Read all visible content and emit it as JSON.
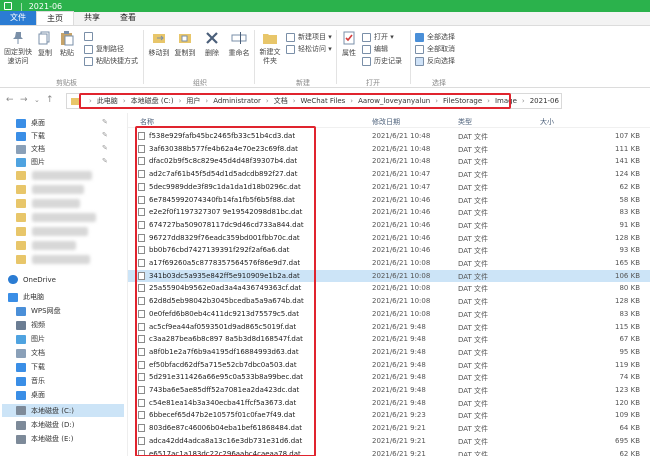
{
  "window": {
    "title": "2021-06"
  },
  "ribbon_tabs": [
    "文件",
    "主页",
    "共享",
    "查看"
  ],
  "ribbon": {
    "clipboard": {
      "pin_label": "固定到快速访问",
      "copy": "复制",
      "paste": "粘贴",
      "copy_path": "复制路径",
      "paste_shortcut": "粘贴快捷方式",
      "group": "剪贴板"
    },
    "organize": {
      "move_to": "移动到",
      "copy_to": "复制到",
      "delete": "删除",
      "rename": "重命名",
      "group": "组织"
    },
    "new": {
      "new_folder": "新建文件夹",
      "new_item": "新建项目 ▾",
      "easy_access": "轻松访问 ▾",
      "group": "新建"
    },
    "open": {
      "properties": "属性",
      "open": "打开 ▾",
      "edit": "编辑",
      "history": "历史记录",
      "group": "打开"
    },
    "select": {
      "select_all": "全部选择",
      "select_none": "全部取消",
      "invert": "反向选择",
      "group": "选择"
    }
  },
  "breadcrumb": [
    "此电脑",
    "本地磁盘 (C:)",
    "用户",
    "Administrator",
    "文档",
    "WeChat Files",
    "Aarow_loveyanyalun",
    "FileStorage",
    "Image",
    "2021-06"
  ],
  "sidebar": {
    "quick": [
      {
        "label": "桌面",
        "icon": "desktop-icon"
      },
      {
        "label": "下载",
        "icon": "download-icon"
      },
      {
        "label": "文档",
        "icon": "document-icon"
      },
      {
        "label": "图片",
        "icon": "picture-icon"
      }
    ],
    "desktop2": "桌面",
    "onedrive": "OneDrive",
    "pc": "此电脑",
    "pc_items": [
      {
        "label": "WPS网盘",
        "icon": "cloud-icon"
      },
      {
        "label": "视频",
        "icon": "video-icon"
      },
      {
        "label": "图片",
        "icon": "picture-icon"
      },
      {
        "label": "文档",
        "icon": "document-icon"
      },
      {
        "label": "下载",
        "icon": "download-icon"
      },
      {
        "label": "音乐",
        "icon": "music-icon"
      },
      {
        "label": "桌面",
        "icon": "desktop-icon"
      },
      {
        "label": "本地磁盘 (C:)",
        "icon": "drive-icon"
      },
      {
        "label": "本地磁盘 (D:)",
        "icon": "drive-icon"
      },
      {
        "label": "本地磁盘 (E:)",
        "icon": "drive-icon"
      }
    ]
  },
  "columns": {
    "name": "名称",
    "date": "修改日期",
    "type": "类型",
    "size": "大小"
  },
  "files": [
    {
      "name": "f538e929fafb45bc2465fb33c51b4cd3.dat",
      "date": "2021/6/21 10:48",
      "type": "DAT 文件",
      "size": "107 KB"
    },
    {
      "name": "3af630388b577fe4b62a4e70e23c69f8.dat",
      "date": "2021/6/21 10:48",
      "type": "DAT 文件",
      "size": "111 KB"
    },
    {
      "name": "dfac02b9f5c8c829e45d4d48f39307b4.dat",
      "date": "2021/6/21 10:48",
      "type": "DAT 文件",
      "size": "141 KB"
    },
    {
      "name": "ad2c7af61b45f5d54d1d5adcdb892f27.dat",
      "date": "2021/6/21 10:47",
      "type": "DAT 文件",
      "size": "124 KB"
    },
    {
      "name": "5dec9989dde3f89c1da1da1d18b0296c.dat",
      "date": "2021/6/21 10:47",
      "type": "DAT 文件",
      "size": "62 KB"
    },
    {
      "name": "6e7845992074340fb14fa1fb5f6b5f88.dat",
      "date": "2021/6/21 10:46",
      "type": "DAT 文件",
      "size": "58 KB"
    },
    {
      "name": "e2e2f0f1197327307 9e19542098d81bc.dat",
      "date": "2021/6/21 10:46",
      "type": "DAT 文件",
      "size": "83 KB"
    },
    {
      "name": "674727ba509078117dc9d46cd733a844.dat",
      "date": "2021/6/21 10:46",
      "type": "DAT 文件",
      "size": "91 KB"
    },
    {
      "name": "96727dd8329f76eadc359bd001fbb70c.dat",
      "date": "2021/6/21 10:46",
      "type": "DAT 文件",
      "size": "128 KB"
    },
    {
      "name": "bb0b76cbd7427139391f292f2af6a6.dat",
      "date": "2021/6/21 10:46",
      "type": "DAT 文件",
      "size": "93 KB"
    },
    {
      "name": "a17f69260a5c8778357564576f86e9d7.dat",
      "date": "2021/6/21 10:08",
      "type": "DAT 文件",
      "size": "165 KB"
    },
    {
      "name": "341b03dc5a935e842ff5e910909e1b2a.dat",
      "date": "2021/6/21 10:08",
      "type": "DAT 文件",
      "size": "106 KB",
      "selected": true
    },
    {
      "name": "25a55904b9562e0ad3a4a436749363cf.dat",
      "date": "2021/6/21 10:08",
      "type": "DAT 文件",
      "size": "80 KB"
    },
    {
      "name": "62d8d5eb98042b3045bcedba5a9a674b.dat",
      "date": "2021/6/21 10:08",
      "type": "DAT 文件",
      "size": "128 KB"
    },
    {
      "name": "0e0fefd6b80eb4c411dc9213d75579c5.dat",
      "date": "2021/6/21 10:08",
      "type": "DAT 文件",
      "size": "83 KB"
    },
    {
      "name": "ac5cf9ea44af0593501d9ad865c5019f.dat",
      "date": "2021/6/21 9:48",
      "type": "DAT 文件",
      "size": "115 KB"
    },
    {
      "name": "c3aa287bea6b8c897 8a5b3d8d168547f.dat",
      "date": "2021/6/21 9:48",
      "type": "DAT 文件",
      "size": "67 KB"
    },
    {
      "name": "a8f0b1e2a7f6b9a4195df16884993d63.dat",
      "date": "2021/6/21 9:48",
      "type": "DAT 文件",
      "size": "95 KB"
    },
    {
      "name": "ef50bfacd62df5a715e52cb7dbc0a503.dat",
      "date": "2021/6/21 9:48",
      "type": "DAT 文件",
      "size": "119 KB"
    },
    {
      "name": "5d291e311426a66e95c0a533b8a99bec.dat",
      "date": "2021/6/21 9:48",
      "type": "DAT 文件",
      "size": "74 KB"
    },
    {
      "name": "743ba6e5ae85dff52a7081ea2da423dc.dat",
      "date": "2021/6/21 9:48",
      "type": "DAT 文件",
      "size": "123 KB"
    },
    {
      "name": "c54e81ea14b3a340ecba41ffcf5a3673.dat",
      "date": "2021/6/21 9:48",
      "type": "DAT 文件",
      "size": "120 KB"
    },
    {
      "name": "6bbecef65d47b2e10575f01c0fae7f49.dat",
      "date": "2021/6/21 9:23",
      "type": "DAT 文件",
      "size": "109 KB"
    },
    {
      "name": "803d6e87c46006b04eba1bef61868484.dat",
      "date": "2021/6/21 9:21",
      "type": "DAT 文件",
      "size": "64 KB"
    },
    {
      "name": "adca42dd4adca8a13c16e3db731e31d6.dat",
      "date": "2021/6/21 9:21",
      "type": "DAT 文件",
      "size": "695 KB"
    },
    {
      "name": "e6517ac1a183dc22c296aabc4caeaa78.dat",
      "date": "2021/6/21 9:21",
      "type": "DAT 文件",
      "size": "62 KB"
    }
  ],
  "colors": {
    "title_green": "#2bb24c",
    "file_tab_blue": "#2b7cd3",
    "selection_blue": "#cce4f7",
    "highlight_red": "#e0242e"
  }
}
